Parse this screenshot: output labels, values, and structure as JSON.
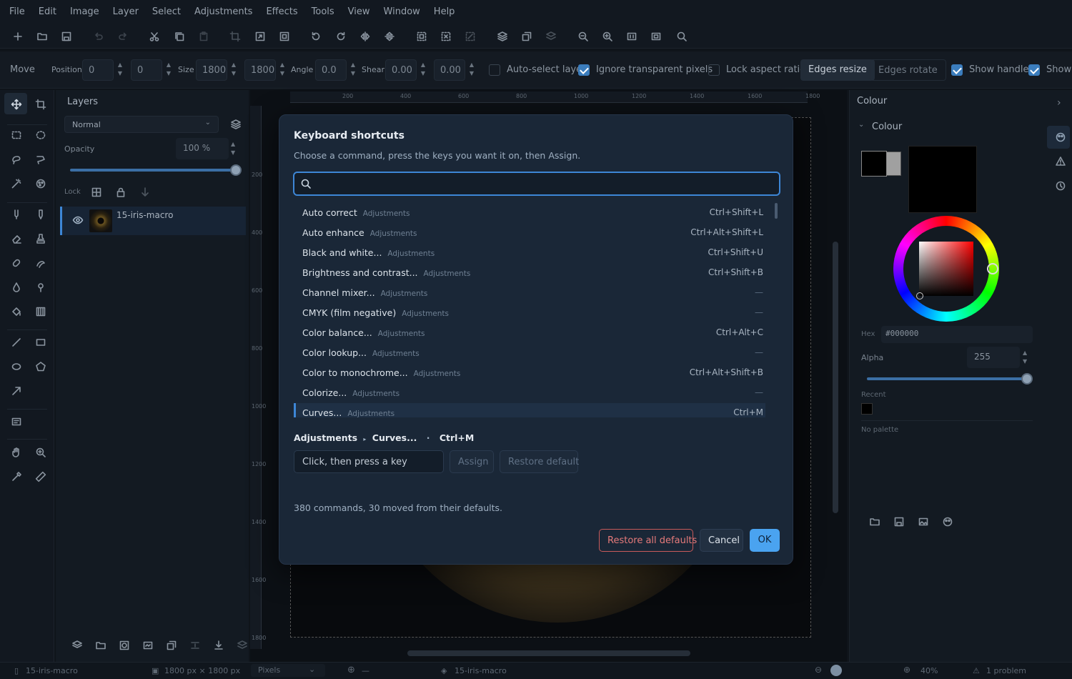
{
  "menu": [
    "File",
    "Edit",
    "Image",
    "Layer",
    "Select",
    "Adjustments",
    "Effects",
    "Tools",
    "View",
    "Window",
    "Help"
  ],
  "options": {
    "tool_name": "Move",
    "position_label": "Position",
    "pos_x": "0",
    "pos_y": "0",
    "size_label": "Size",
    "size_w": "1800",
    "size_h": "1800",
    "angle_label": "Angle",
    "angle": "0.0",
    "shear_label": "Shear",
    "shear_x": "0.00",
    "shear_y": "0.00",
    "auto_select": "Auto-select layer",
    "ignore_transparent": "Ignore transparent pixels",
    "lock_aspect": "Lock aspect ratio",
    "edges_resize": "Edges resize",
    "edges_rotate": "Edges rotate",
    "show_handles": "Show handles",
    "show_trailing": "Show"
  },
  "layers": {
    "title": "Layers",
    "blend": "Normal",
    "opacity_label": "Opacity",
    "opacity": "100 %",
    "opacity_fraction": 1.0,
    "lock_label": "Lock",
    "layer_name": "15-iris-macro"
  },
  "ruler_top": [
    "200",
    "400",
    "600",
    "800",
    "1000",
    "1200",
    "1400",
    "1600",
    "1800"
  ],
  "ruler_left": [
    "200",
    "400",
    "600",
    "800",
    "1000",
    "1200",
    "1400",
    "1600",
    "1800"
  ],
  "colour": {
    "panel_title": "Colour",
    "section": "Colour",
    "hex_label": "Hex",
    "hex": "#000000",
    "alpha_label": "Alpha",
    "alpha": "255",
    "alpha_fraction": 1.0,
    "recent_label": "Recent",
    "palette_text": "No palette"
  },
  "dialog": {
    "title": "Keyboard shortcuts",
    "subtitle": "Choose a command, press the keys you want it on, then Assign.",
    "search_value": "",
    "commands": [
      {
        "name": "Auto correct",
        "category": "Adjustments",
        "shortcut": "Ctrl+Shift+L"
      },
      {
        "name": "Auto enhance",
        "category": "Adjustments",
        "shortcut": "Ctrl+Alt+Shift+L"
      },
      {
        "name": "Black and white...",
        "category": "Adjustments",
        "shortcut": "Ctrl+Shift+U"
      },
      {
        "name": "Brightness and contrast...",
        "category": "Adjustments",
        "shortcut": "Ctrl+Shift+B"
      },
      {
        "name": "Channel mixer...",
        "category": "Adjustments",
        "shortcut": "—"
      },
      {
        "name": "CMYK (film negative)",
        "category": "Adjustments",
        "shortcut": "—"
      },
      {
        "name": "Color balance...",
        "category": "Adjustments",
        "shortcut": "Ctrl+Alt+C"
      },
      {
        "name": "Color lookup...",
        "category": "Adjustments",
        "shortcut": "—"
      },
      {
        "name": "Color to monochrome...",
        "category": "Adjustments",
        "shortcut": "Ctrl+Alt+Shift+B"
      },
      {
        "name": "Colorize...",
        "category": "Adjustments",
        "shortcut": "—"
      },
      {
        "name": "Curves...",
        "category": "Adjustments",
        "shortcut": "Ctrl+M"
      }
    ],
    "selected": {
      "path_1": "Adjustments",
      "path_2": "Curves...",
      "sep": "·",
      "shortcut": "Ctrl+M"
    },
    "key_input_placeholder": "Click, then press a key",
    "assign": "Assign",
    "restore_default": "Restore default",
    "summary": "380 commands, 30 moved from their defaults.",
    "restore_all": "Restore all defaults",
    "cancel": "Cancel",
    "ok": "OK"
  },
  "status": {
    "doc": "15-iris-macro",
    "dims": "1800 px × 1800 px",
    "units": "Pixels",
    "cursor": "—",
    "layer": "15-iris-macro",
    "zoom": "40%",
    "problems": "1 problem"
  },
  "colors": {
    "accent": "#3d86d6",
    "ok": "#4aa3f0",
    "danger": "#e06c6c"
  }
}
